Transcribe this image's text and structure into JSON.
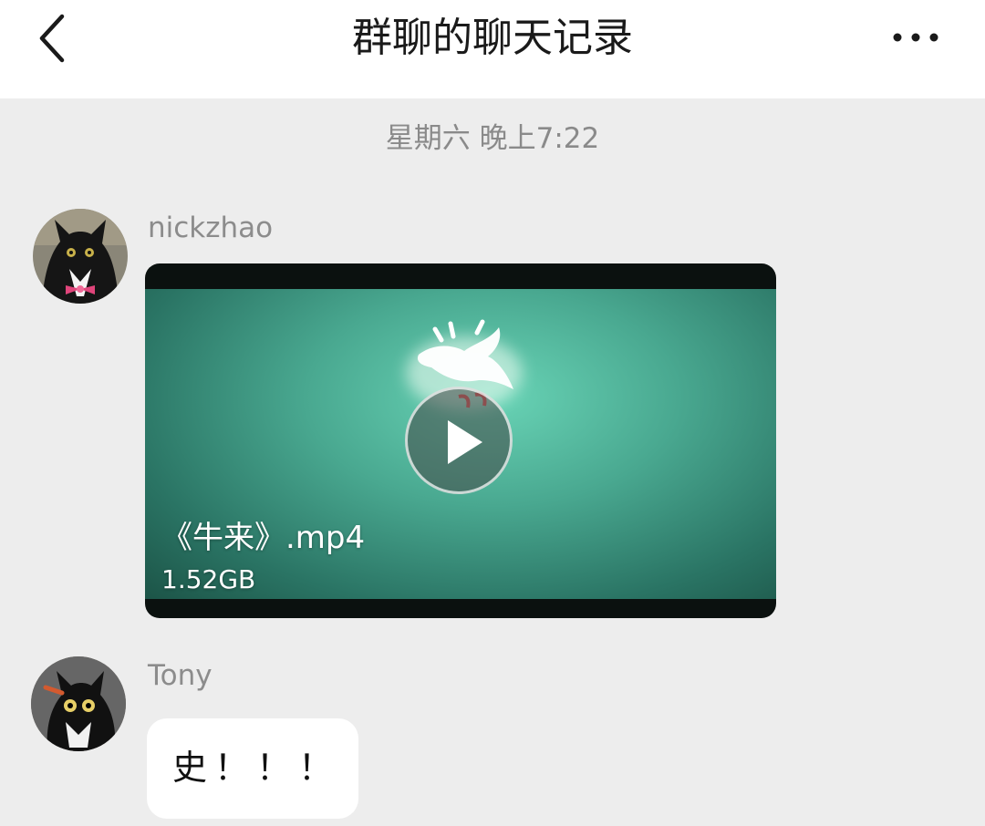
{
  "header": {
    "title": "群聊的聊天记录",
    "back_icon": "chevron-left-icon",
    "more_icon": "more-dots-icon"
  },
  "timestamp": "星期六 晚上7:22",
  "messages": [
    {
      "sender": "nickzhao",
      "avatar": "black-cat-bowtie-avatar",
      "type": "video",
      "video": {
        "file_name": "《牛来》.mp4",
        "file_size": "1.52GB",
        "play_icon": "play-icon"
      }
    },
    {
      "sender": "Tony",
      "avatar": "tuxedo-cat-avatar",
      "type": "text",
      "text": "史！！！"
    }
  ],
  "colors": {
    "page_background": "#ededed",
    "header_background": "#ffffff",
    "bubble_background": "#ffffff",
    "video_green": "#49a890"
  }
}
